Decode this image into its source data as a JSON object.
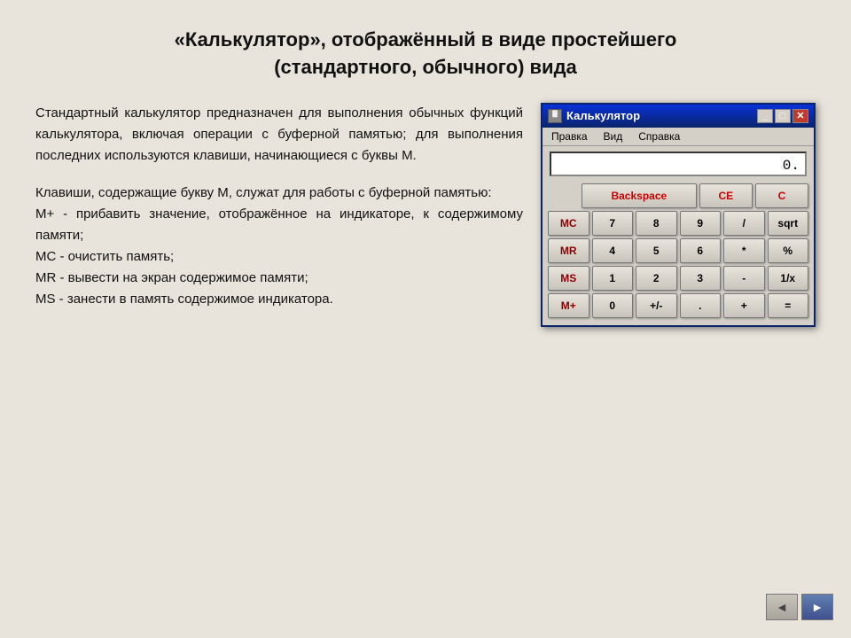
{
  "slide": {
    "title": "«Калькулятор», отображённый в виде простейшего (стандартного, обычного) вида",
    "text1": "Стандартный калькулятор предназначен для выполнения обычных функций калькулятора, включая операции с буферной памятью; для выполнения последних используются клавиши, начинающиеся с буквы М.",
    "text2": "Клавиши, содержащие букву М, служат для работы с буферной памятью:\nМ+ - прибавить значение, отображённое на индикаторе, к содержимому памяти;\nМС - очистить память;\nMR - вывести на экран содержимое памяти;\nMS - занести в память содержимое индикатора."
  },
  "calculator": {
    "title": "Калькулятор",
    "display": "0.",
    "menu": [
      "Правка",
      "Вид",
      "Справка"
    ],
    "buttons": {
      "row0_backspace": "Backspace",
      "row0_ce": "CE",
      "row0_c": "C",
      "row1": [
        "MC",
        "7",
        "8",
        "9",
        "/",
        "sqrt"
      ],
      "row2": [
        "MR",
        "4",
        "5",
        "6",
        "*",
        "%"
      ],
      "row3": [
        "MS",
        "1",
        "2",
        "3",
        "-",
        "1/x"
      ],
      "row4": [
        "M+",
        "0",
        "+/-",
        ".",
        "+",
        "="
      ]
    }
  },
  "nav": {
    "back_label": "◄",
    "forward_label": "►"
  }
}
